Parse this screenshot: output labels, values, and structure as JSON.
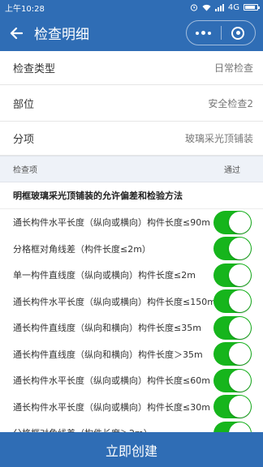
{
  "status_bar": {
    "time": "上午10:28",
    "network": "4G"
  },
  "nav": {
    "title": "检查明细",
    "back_icon": "back-arrow-icon",
    "more_icon": "more-dots-icon",
    "close_icon": "target-close-icon"
  },
  "info": [
    {
      "label": "检查类型",
      "value": "日常检查"
    },
    {
      "label": "部位",
      "value": "安全检查2"
    },
    {
      "label": "分项",
      "value": "玻璃采光顶铺装"
    }
  ],
  "table": {
    "col_item": "检查项",
    "col_pass": "通过",
    "section_title": "明框玻璃采光顶铺装的允许偏差和检验方法",
    "rows": [
      {
        "text": "通长构件水平长度（纵向或横向）构件长度≤90m",
        "pass": true
      },
      {
        "text": "分格框对角线差（构件长度≤2m）",
        "pass": true
      },
      {
        "text": "单一构件直线度（纵向或横向）构件长度≤2m",
        "pass": true
      },
      {
        "text": "通长构件水平长度（纵向或横向）构件长度≤150m",
        "pass": true
      },
      {
        "text": "通长构件直线度（纵向和横向）构件长度≤35m",
        "pass": true
      },
      {
        "text": "通长构件直线度（纵向和横向）构件长度＞35m",
        "pass": true
      },
      {
        "text": "通长构件水平长度（纵向或横向）构件长度≤60m",
        "pass": true
      },
      {
        "text": "通长构件水平长度（纵向或横向）构件长度≤30m",
        "pass": true
      },
      {
        "text": "分格框对角线差（构件长度＞2m）",
        "pass": true
      }
    ]
  },
  "footer": {
    "create_label": "立即创建"
  },
  "colors": {
    "primary": "#2f6db5",
    "switch_on": "#16b51c"
  }
}
